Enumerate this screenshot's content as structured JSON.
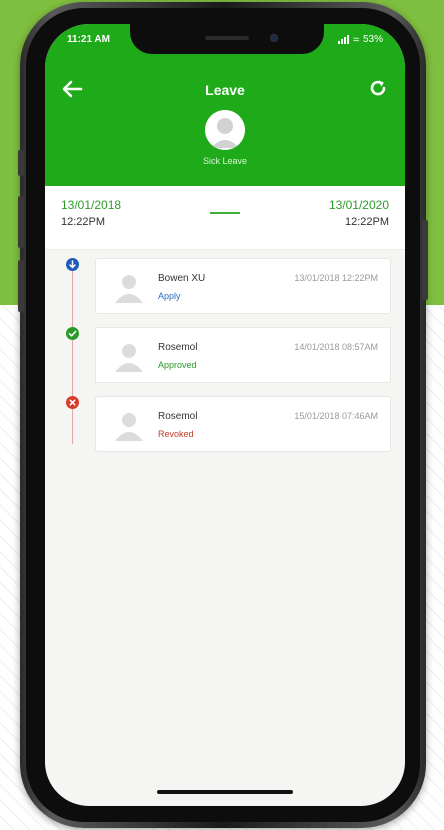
{
  "status_bar": {
    "time": "11:21 AM",
    "battery": "53%"
  },
  "header": {
    "title": "Leave",
    "leave_type": "Sick Leave",
    "back_icon": "arrow-left-icon",
    "refresh_icon": "refresh-icon",
    "color": "#1faa1a"
  },
  "date_range": {
    "from": {
      "date": "13/01/2018",
      "time": "12:22PM"
    },
    "to": {
      "date": "13/01/2020",
      "time": "12:22PM"
    }
  },
  "timeline": [
    {
      "name": "Bowen XU",
      "status": "Apply",
      "timestamp": "13/01/2018 12:22PM",
      "icon": "arrow-down-icon",
      "icon_color": "#1e5bb8",
      "status_color": "#2a6fbf"
    },
    {
      "name": "Rosemol",
      "status": "Approved",
      "timestamp": "14/01/2018 08:57AM",
      "icon": "check-icon",
      "icon_color": "#2a9a2a",
      "status_color": "#2a9a2a"
    },
    {
      "name": "Rosemol",
      "status": "Revoked",
      "timestamp": "15/01/2018 07:46AM",
      "icon": "close-icon",
      "icon_color": "#d93b2b",
      "status_color": "#c43a2a"
    }
  ]
}
